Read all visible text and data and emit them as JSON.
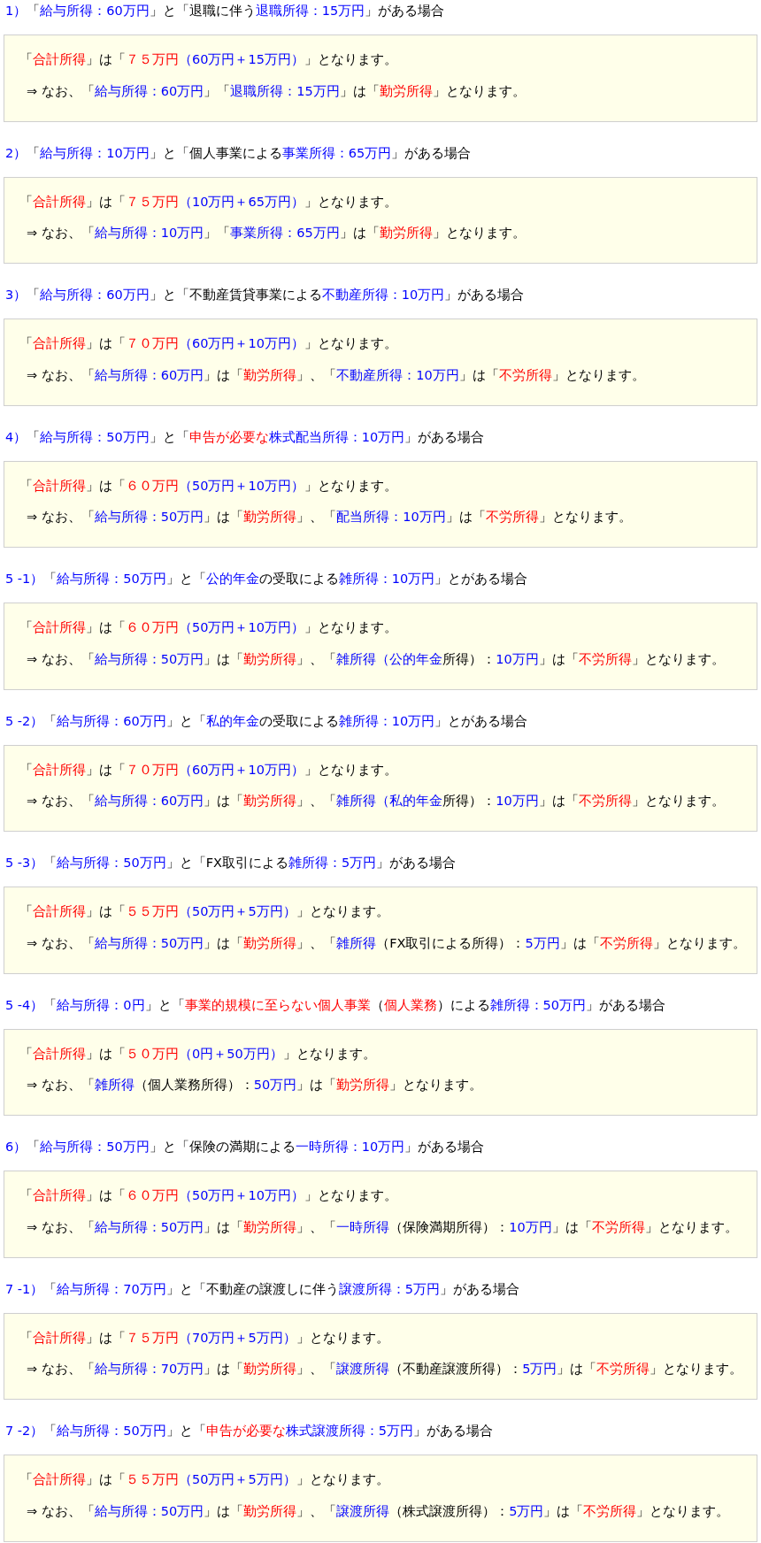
{
  "cases": [
    {
      "heading": [
        {
          "text": "1）",
          "color": "#0000ff"
        },
        {
          "text": "「"
        },
        {
          "text": "給与所得：60万円",
          "color": "#0000ff"
        },
        {
          "text": "」と「退職に伴う"
        },
        {
          "text": "退職所得：15万円",
          "color": "#0000ff"
        },
        {
          "text": "」がある場合"
        }
      ],
      "total": [
        {
          "text": "「"
        },
        {
          "text": "合計所得",
          "color": "#ff0000"
        },
        {
          "text": "」は「"
        },
        {
          "text": "７５万円",
          "color": "#ff0000"
        },
        {
          "text": "（60万円＋15万円）",
          "color": "#0000ff"
        },
        {
          "text": "」となります。"
        }
      ],
      "note": [
        {
          "text": "⇒ なお、「"
        },
        {
          "text": "給与所得：60万円",
          "color": "#0000ff"
        },
        {
          "text": "」「"
        },
        {
          "text": "退職所得：15万円",
          "color": "#0000ff"
        },
        {
          "text": "」は「"
        },
        {
          "text": "勤労所得",
          "color": "#ff0000"
        },
        {
          "text": "」となります。"
        }
      ]
    },
    {
      "heading": [
        {
          "text": "2）",
          "color": "#0000ff"
        },
        {
          "text": "「"
        },
        {
          "text": "給与所得：10万円",
          "color": "#0000ff"
        },
        {
          "text": "」と「個人事業による"
        },
        {
          "text": "事業所得：65万円",
          "color": "#0000ff"
        },
        {
          "text": "」がある場合"
        }
      ],
      "total": [
        {
          "text": "「"
        },
        {
          "text": "合計所得",
          "color": "#ff0000"
        },
        {
          "text": "」は「"
        },
        {
          "text": "７５万円",
          "color": "#ff0000"
        },
        {
          "text": "（10万円＋65万円）",
          "color": "#0000ff"
        },
        {
          "text": "」となります。"
        }
      ],
      "note": [
        {
          "text": "⇒ なお、「"
        },
        {
          "text": "給与所得：10万円",
          "color": "#0000ff"
        },
        {
          "text": "」「"
        },
        {
          "text": "事業所得：65万円",
          "color": "#0000ff"
        },
        {
          "text": "」は「"
        },
        {
          "text": "勤労所得",
          "color": "#ff0000"
        },
        {
          "text": "」となります。"
        }
      ]
    },
    {
      "heading": [
        {
          "text": "3）",
          "color": "#0000ff"
        },
        {
          "text": "「"
        },
        {
          "text": "給与所得：60万円",
          "color": "#0000ff"
        },
        {
          "text": "」と「不動産賃貸事業による"
        },
        {
          "text": "不動産所得：10万円",
          "color": "#0000ff"
        },
        {
          "text": "」がある場合"
        }
      ],
      "total": [
        {
          "text": "「"
        },
        {
          "text": "合計所得",
          "color": "#ff0000"
        },
        {
          "text": "」は「"
        },
        {
          "text": "７０万円",
          "color": "#ff0000"
        },
        {
          "text": "（60万円＋10万円）",
          "color": "#0000ff"
        },
        {
          "text": "」となります。"
        }
      ],
      "note": [
        {
          "text": "⇒ なお、「"
        },
        {
          "text": "給与所得：60万円",
          "color": "#0000ff"
        },
        {
          "text": "」は「"
        },
        {
          "text": "勤労所得",
          "color": "#ff0000"
        },
        {
          "text": "」、「"
        },
        {
          "text": "不動産所得：10万円",
          "color": "#0000ff"
        },
        {
          "text": "」は「"
        },
        {
          "text": "不労所得",
          "color": "#ff0000"
        },
        {
          "text": "」となります。"
        }
      ]
    },
    {
      "heading": [
        {
          "text": "4）",
          "color": "#0000ff"
        },
        {
          "text": "「"
        },
        {
          "text": "給与所得：50万円",
          "color": "#0000ff"
        },
        {
          "text": "」と「"
        },
        {
          "text": "申告が必要な",
          "color": "#ff0000"
        },
        {
          "text": "株式配当所得：10万円",
          "color": "#0000ff"
        },
        {
          "text": "」がある場合"
        }
      ],
      "total": [
        {
          "text": "「"
        },
        {
          "text": "合計所得",
          "color": "#ff0000"
        },
        {
          "text": "」は「"
        },
        {
          "text": "６０万円",
          "color": "#ff0000"
        },
        {
          "text": "（50万円＋10万円）",
          "color": "#0000ff"
        },
        {
          "text": "」となります。"
        }
      ],
      "note": [
        {
          "text": "⇒ なお、「"
        },
        {
          "text": "給与所得：50万円",
          "color": "#0000ff"
        },
        {
          "text": "」は「"
        },
        {
          "text": "勤労所得",
          "color": "#ff0000"
        },
        {
          "text": "」、「"
        },
        {
          "text": "配当所得：10万円",
          "color": "#0000ff"
        },
        {
          "text": "」は「"
        },
        {
          "text": "不労所得",
          "color": "#ff0000"
        },
        {
          "text": "」となります。"
        }
      ]
    },
    {
      "heading": [
        {
          "text": "5 -1）",
          "color": "#0000ff"
        },
        {
          "text": "「"
        },
        {
          "text": "給与所得：50万円",
          "color": "#0000ff"
        },
        {
          "text": "」と「"
        },
        {
          "text": "公的年金",
          "color": "#0000ff"
        },
        {
          "text": "の受取による"
        },
        {
          "text": "雑所得：10万円",
          "color": "#0000ff"
        },
        {
          "text": "」とがある場合"
        }
      ],
      "total": [
        {
          "text": "「"
        },
        {
          "text": "合計所得",
          "color": "#ff0000"
        },
        {
          "text": "」は「"
        },
        {
          "text": "６０万円",
          "color": "#ff0000"
        },
        {
          "text": "（50万円＋10万円）",
          "color": "#0000ff"
        },
        {
          "text": "」となります。"
        }
      ],
      "note": [
        {
          "text": "⇒ なお、「"
        },
        {
          "text": "給与所得：50万円",
          "color": "#0000ff"
        },
        {
          "text": "」は「"
        },
        {
          "text": "勤労所得",
          "color": "#ff0000"
        },
        {
          "text": "」、「"
        },
        {
          "text": "雑所得（公的年金",
          "color": "#0000ff"
        },
        {
          "text": "所得）："
        },
        {
          "text": "10万円",
          "color": "#0000ff"
        },
        {
          "text": "」は「"
        },
        {
          "text": "不労所得",
          "color": "#ff0000"
        },
        {
          "text": "」となります。"
        }
      ]
    },
    {
      "heading": [
        {
          "text": "5 -2）",
          "color": "#0000ff"
        },
        {
          "text": "「"
        },
        {
          "text": "給与所得：60万円",
          "color": "#0000ff"
        },
        {
          "text": "」と「"
        },
        {
          "text": "私的年金",
          "color": "#0000ff"
        },
        {
          "text": "の受取による"
        },
        {
          "text": "雑所得：10万円",
          "color": "#0000ff"
        },
        {
          "text": "」とがある場合"
        }
      ],
      "total": [
        {
          "text": "「"
        },
        {
          "text": "合計所得",
          "color": "#ff0000"
        },
        {
          "text": "」は「"
        },
        {
          "text": "７０万円",
          "color": "#ff0000"
        },
        {
          "text": "（60万円＋10万円）",
          "color": "#0000ff"
        },
        {
          "text": "」となります。"
        }
      ],
      "note": [
        {
          "text": "⇒ なお、「"
        },
        {
          "text": "給与所得：60万円",
          "color": "#0000ff"
        },
        {
          "text": "」は「"
        },
        {
          "text": "勤労所得",
          "color": "#ff0000"
        },
        {
          "text": "」、「"
        },
        {
          "text": "雑所得（私的年金",
          "color": "#0000ff"
        },
        {
          "text": "所得）："
        },
        {
          "text": "10万円",
          "color": "#0000ff"
        },
        {
          "text": "」は「"
        },
        {
          "text": "不労所得",
          "color": "#ff0000"
        },
        {
          "text": "」となります。"
        }
      ]
    },
    {
      "heading": [
        {
          "text": "5 -3）",
          "color": "#0000ff"
        },
        {
          "text": "「"
        },
        {
          "text": "給与所得：50万円",
          "color": "#0000ff"
        },
        {
          "text": "」と「FX取引による"
        },
        {
          "text": "雑所得：5万円",
          "color": "#0000ff"
        },
        {
          "text": "」がある場合"
        }
      ],
      "total": [
        {
          "text": "「"
        },
        {
          "text": "合計所得",
          "color": "#ff0000"
        },
        {
          "text": "」は「"
        },
        {
          "text": "５５万円",
          "color": "#ff0000"
        },
        {
          "text": "（50万円＋5万円）",
          "color": "#0000ff"
        },
        {
          "text": "」となります。"
        }
      ],
      "note": [
        {
          "text": "⇒ なお、「"
        },
        {
          "text": "給与所得：50万円",
          "color": "#0000ff"
        },
        {
          "text": "」は「"
        },
        {
          "text": "勤労所得",
          "color": "#ff0000"
        },
        {
          "text": "」、「"
        },
        {
          "text": "雑所得",
          "color": "#0000ff"
        },
        {
          "text": "（FX取引による所得）："
        },
        {
          "text": "5万円",
          "color": "#0000ff"
        },
        {
          "text": "」は「"
        },
        {
          "text": "不労所得",
          "color": "#ff0000"
        },
        {
          "text": "」となります。"
        }
      ]
    },
    {
      "heading": [
        {
          "text": "5 -4）",
          "color": "#0000ff"
        },
        {
          "text": "「"
        },
        {
          "text": "給与所得：0円",
          "color": "#0000ff"
        },
        {
          "text": "」と「"
        },
        {
          "text": "事業的規模に至らない個人事業",
          "color": "#ff0000"
        },
        {
          "text": "（"
        },
        {
          "text": "個人業務",
          "color": "#ff0000"
        },
        {
          "text": "）による"
        },
        {
          "text": "雑所得：50万円",
          "color": "#0000ff"
        },
        {
          "text": "」がある場合"
        }
      ],
      "total": [
        {
          "text": "「"
        },
        {
          "text": "合計所得",
          "color": "#ff0000"
        },
        {
          "text": "」は「"
        },
        {
          "text": "５０万円",
          "color": "#ff0000"
        },
        {
          "text": "（0円＋50万円）",
          "color": "#0000ff"
        },
        {
          "text": "」となります。"
        }
      ],
      "note": [
        {
          "text": "⇒ なお、「"
        },
        {
          "text": "雑所得",
          "color": "#0000ff"
        },
        {
          "text": "（個人業務所得）："
        },
        {
          "text": "50万円",
          "color": "#0000ff"
        },
        {
          "text": "」は「"
        },
        {
          "text": "勤労所得",
          "color": "#ff0000"
        },
        {
          "text": "」となります。"
        }
      ]
    },
    {
      "heading": [
        {
          "text": "6）",
          "color": "#0000ff"
        },
        {
          "text": "「"
        },
        {
          "text": "給与所得：50万円",
          "color": "#0000ff"
        },
        {
          "text": "」と「保険の満期による"
        },
        {
          "text": "一時所得：10万円",
          "color": "#0000ff"
        },
        {
          "text": "」がある場合"
        }
      ],
      "total": [
        {
          "text": "「"
        },
        {
          "text": "合計所得",
          "color": "#ff0000"
        },
        {
          "text": "」は「"
        },
        {
          "text": "６０万円",
          "color": "#ff0000"
        },
        {
          "text": "（50万円＋10万円）",
          "color": "#0000ff"
        },
        {
          "text": "」となります。"
        }
      ],
      "note": [
        {
          "text": "⇒ なお、「"
        },
        {
          "text": "給与所得：50万円",
          "color": "#0000ff"
        },
        {
          "text": "」は「"
        },
        {
          "text": "勤労所得",
          "color": "#ff0000"
        },
        {
          "text": "」、「"
        },
        {
          "text": "一時所得",
          "color": "#0000ff"
        },
        {
          "text": "（保険満期所得）："
        },
        {
          "text": "10万円",
          "color": "#0000ff"
        },
        {
          "text": "」は「"
        },
        {
          "text": "不労所得",
          "color": "#ff0000"
        },
        {
          "text": "」となります。"
        }
      ]
    },
    {
      "heading": [
        {
          "text": "7 -1）",
          "color": "#0000ff"
        },
        {
          "text": "「"
        },
        {
          "text": "給与所得：70万円",
          "color": "#0000ff"
        },
        {
          "text": "」と「不動産の譲渡しに伴う"
        },
        {
          "text": "譲渡所得：5万円",
          "color": "#0000ff"
        },
        {
          "text": "」がある場合"
        }
      ],
      "total": [
        {
          "text": "「"
        },
        {
          "text": "合計所得",
          "color": "#ff0000"
        },
        {
          "text": "」は「"
        },
        {
          "text": "７５万円",
          "color": "#ff0000"
        },
        {
          "text": "（70万円＋5万円）",
          "color": "#0000ff"
        },
        {
          "text": "」となります。"
        }
      ],
      "note": [
        {
          "text": "⇒ なお、「"
        },
        {
          "text": "給与所得：70万円",
          "color": "#0000ff"
        },
        {
          "text": "」は「"
        },
        {
          "text": "勤労所得",
          "color": "#ff0000"
        },
        {
          "text": "」、「"
        },
        {
          "text": "譲渡所得",
          "color": "#0000ff"
        },
        {
          "text": "（不動産譲渡所得）："
        },
        {
          "text": "5万円",
          "color": "#0000ff"
        },
        {
          "text": "」は「"
        },
        {
          "text": "不労所得",
          "color": "#ff0000"
        },
        {
          "text": "」となります。"
        }
      ]
    },
    {
      "heading": [
        {
          "text": "7 -2）",
          "color": "#0000ff"
        },
        {
          "text": "「"
        },
        {
          "text": "給与所得：50万円",
          "color": "#0000ff"
        },
        {
          "text": "」と「"
        },
        {
          "text": "申告が必要な",
          "color": "#ff0000"
        },
        {
          "text": "株式譲渡所得：5万円",
          "color": "#0000ff"
        },
        {
          "text": "」がある場合"
        }
      ],
      "total": [
        {
          "text": "「"
        },
        {
          "text": "合計所得",
          "color": "#ff0000"
        },
        {
          "text": "」は「"
        },
        {
          "text": "５５万円",
          "color": "#ff0000"
        },
        {
          "text": "（50万円＋5万円）",
          "color": "#0000ff"
        },
        {
          "text": "」となります。"
        }
      ],
      "note": [
        {
          "text": "⇒ なお、「"
        },
        {
          "text": "給与所得：50万円",
          "color": "#0000ff"
        },
        {
          "text": "」は「"
        },
        {
          "text": "勤労所得",
          "color": "#ff0000"
        },
        {
          "text": "」、「"
        },
        {
          "text": "譲渡所得",
          "color": "#0000ff"
        },
        {
          "text": "（株式譲渡所得）："
        },
        {
          "text": "5万円",
          "color": "#0000ff"
        },
        {
          "text": "」は「"
        },
        {
          "text": "不労所得",
          "color": "#ff0000"
        },
        {
          "text": "」となります。"
        }
      ]
    }
  ]
}
